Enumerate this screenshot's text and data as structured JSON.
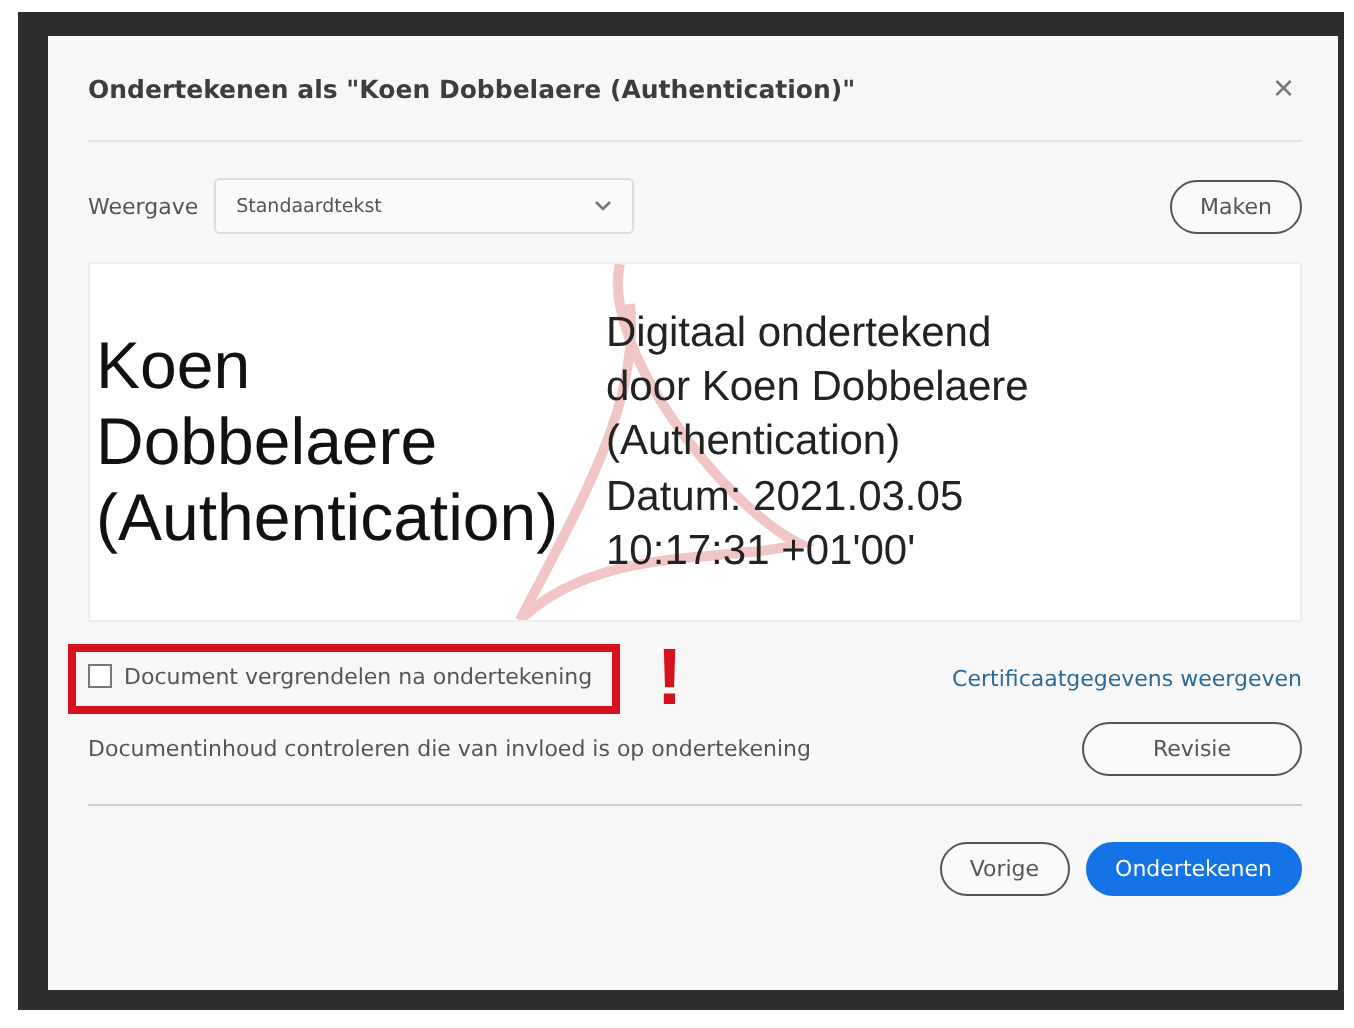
{
  "dialog": {
    "title": "Ondertekenen als \"Koen Dobbelaere (Authentication)\"",
    "close": "×"
  },
  "appearance": {
    "label": "Weergave",
    "value": "Standaardtekst",
    "create_button": "Maken"
  },
  "preview": {
    "name": "Koen Dobbelaere (Authentication)",
    "details": [
      "Digitaal ondertekend",
      "door Koen Dobbelaere",
      "(Authentication)",
      "Datum: 2021.03.05",
      "10:17:31 +01'00'"
    ]
  },
  "lock": {
    "label": "Document vergrendelen na ondertekening",
    "checked": false,
    "highlighted": true,
    "annotation": "!"
  },
  "certificate_link": "Certificaatgegevens weergeven",
  "review": {
    "label": "Documentinhoud controleren die van invloed is op ondertekening",
    "button": "Revisie"
  },
  "buttons": [
    {
      "label": "Vorige",
      "kind": "secondary"
    },
    {
      "label": "Ondertekenen",
      "kind": "primary"
    }
  ]
}
